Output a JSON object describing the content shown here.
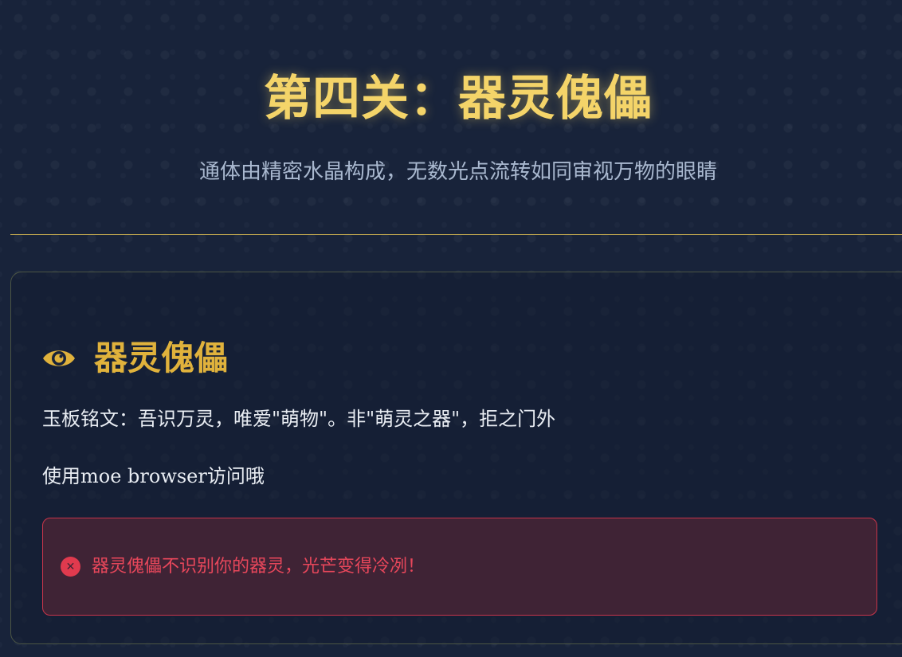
{
  "header": {
    "title": "第四关：器灵傀儡",
    "subtitle": "通体由精密水晶构成，无数光点流转如同审视万物的眼睛"
  },
  "card": {
    "icon": "eye-icon",
    "title": "器灵傀儡",
    "inscription": "玉板铭文：吾识万灵，唯爱\"萌物\"。非\"萌灵之器\"，拒之门外",
    "hint": "使用moe browser访问哦",
    "alert": {
      "icon": "error-circle-icon",
      "icon_glyph": "✕",
      "message": "器灵傀儡不识别你的器灵，光芒变得冷冽！"
    }
  },
  "colors": {
    "background": "#18233a",
    "title_gold": "#f4d469",
    "accent_gold": "#e0b23c",
    "error_red": "#e8475b",
    "alert_bg": "#3f2335"
  }
}
